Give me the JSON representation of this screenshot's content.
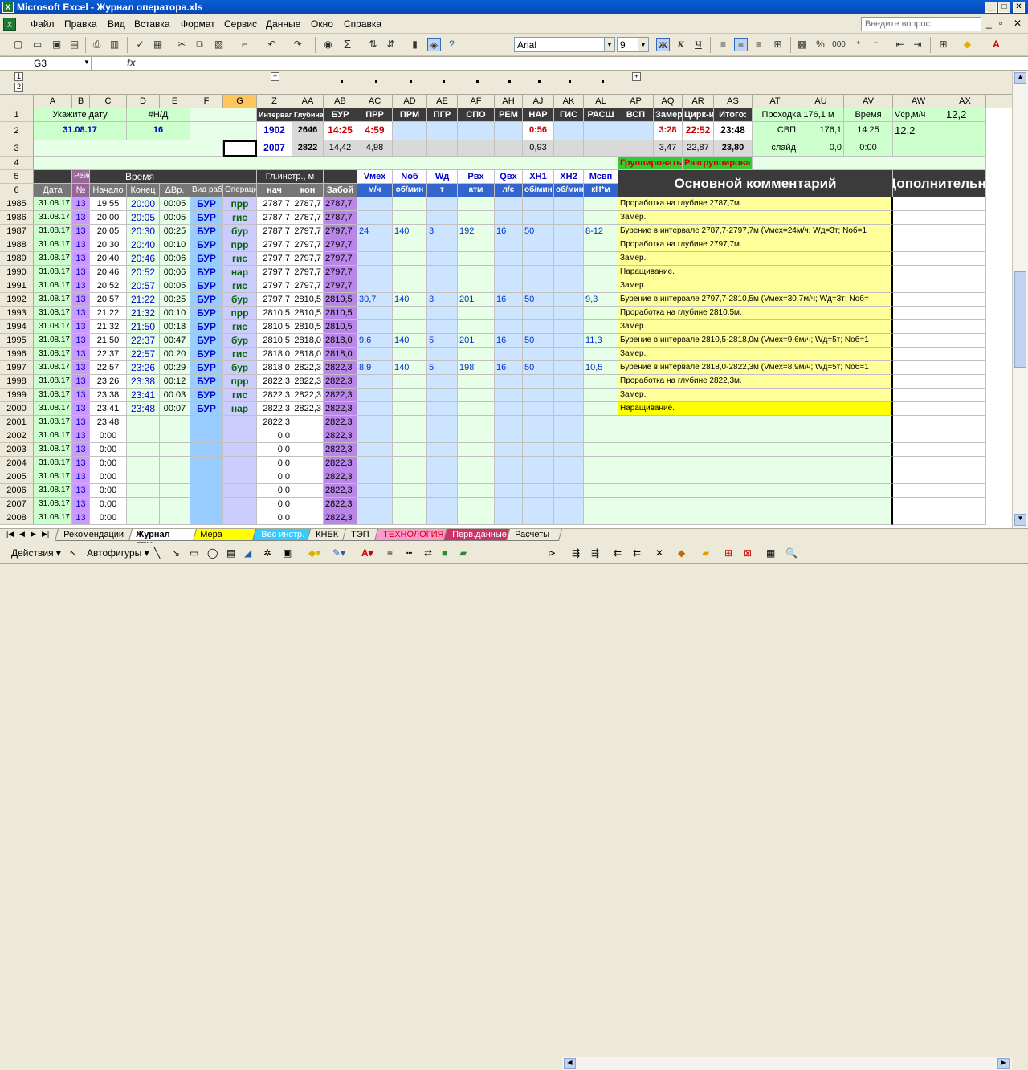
{
  "app": {
    "title": "Microsoft Excel - Журнал оператора.xls",
    "app_icon": "excel-icon"
  },
  "menu": {
    "items": [
      "Файл",
      "Правка",
      "Вид",
      "Вставка",
      "Формат",
      "Сервис",
      "Данные",
      "Окно",
      "Справка"
    ],
    "help_placeholder": "Введите вопрос"
  },
  "toolbar": {
    "font_name": "Arial",
    "font_size": "9",
    "bold": "Ж",
    "italic": "К",
    "underline": "Ч",
    "sigma": "Σ",
    "percent": "%",
    "thousands": "000"
  },
  "formula_bar": {
    "name_box": "G3",
    "fx": "fx",
    "value": ""
  },
  "columns": [
    "A",
    "B",
    "C",
    "D",
    "E",
    "F",
    "G",
    "Z",
    "AA",
    "AB",
    "AC",
    "AD",
    "AE",
    "AF",
    "AH",
    "AJ",
    "AK",
    "AL",
    "AP",
    "AQ",
    "AR",
    "AS",
    "AT",
    "AU",
    "AV",
    "AW",
    "AX"
  ],
  "outline": {
    "level1": "1",
    "level2": "2",
    "plus": "+"
  },
  "top": {
    "date_label": "Укажите дату",
    "date_value": "31.08.17",
    "nd_label": "#Н/Д",
    "nd_value": "16",
    "interval_label": "Интервал",
    "depth_label": "Глубина",
    "z2": "1902",
    "aa2": "2646",
    "z3": "2007",
    "aa3": "2822",
    "ops_headers": [
      "БУР",
      "ПРР",
      "ПРМ",
      "ПГР",
      "СПО",
      "РЕМ",
      "НАР",
      "ГИС",
      "РАСШ",
      "ВСП",
      "Замер",
      "Цирк-ия",
      "Итого:"
    ],
    "row2_vals": {
      "bur": "14:25",
      "prr": "4:59",
      "nar": "0:56",
      "zamer": "3:28",
      "cirk": "22:52",
      "itogo": "23:48"
    },
    "row3_vals": {
      "bur": "14,42",
      "prr": "4,98",
      "nar": "0,93",
      "zamer": "3,47",
      "cirk": "22,87",
      "itogo": "23,80"
    },
    "prohodka_label": "Проходка 176,1 м",
    "vremya_label": "Время",
    "vsr_label": "Vср,м/ч",
    "ax1": "12,2",
    "svp_label": "СВП",
    "svp_val": "176,1",
    "svp_time": "14:25",
    "svp_vsr": "12,2",
    "slide_label": "слайд",
    "slide_val": "0,0",
    "slide_time": "0:00",
    "group_btn": "Группировать",
    "ungroup_btn": "Разгруппировать"
  },
  "table_headers": {
    "r5": {
      "rejs": "Рейс",
      "vremya": "Время",
      "gl_instr": "Гл.инстр., м",
      "vmeh": "Vмех",
      "nob": "Nоб",
      "wd": "Wд",
      "rvh": "Рвх",
      "qvh": "Qвх",
      "xn1": "ХН1",
      "xn2": "ХН2",
      "msvp": "Мсвп"
    },
    "r6": {
      "date": "Дата",
      "no": "№",
      "start": "Начало",
      "end": "Конец",
      "dvr": "ΔВр.",
      "vid_raboty": "Вид работы",
      "operacii": "Операции",
      "nach": "нач",
      "kon": "кон",
      "zaboi": "Забой",
      "vmeh_u": "м/ч",
      "nob_u": "об/мин",
      "wd_u": "т",
      "rvh_u": "атм",
      "qvh_u": "л/с",
      "xn1_u": "об/мин",
      "xn2_u": "об/мин",
      "msvp_u": "кН*м"
    },
    "main_comment": "Основной комментарий",
    "extra_comment": "Дополнительный"
  },
  "rows": [
    {
      "n": "1985",
      "date": "31.08.17",
      "no": "13",
      "start": "19:55",
      "end": "20:00",
      "dvr": "00:05",
      "vid": "БУР",
      "op": "прр",
      "nach": "2787,7",
      "kon": "2787,7",
      "zaboi": "2787,7",
      "vmeh": "",
      "nob": "",
      "wd": "",
      "rvh": "",
      "qvh": "",
      "xn1": "",
      "msvp": "",
      "comment": "Проработка на глубине 2787,7м."
    },
    {
      "n": "1986",
      "date": "31.08.17",
      "no": "13",
      "start": "20:00",
      "end": "20:05",
      "dvr": "00:05",
      "vid": "БУР",
      "op": "гис",
      "nach": "2787,7",
      "kon": "2787,7",
      "zaboi": "2787,7",
      "vmeh": "",
      "nob": "",
      "wd": "",
      "rvh": "",
      "qvh": "",
      "xn1": "",
      "msvp": "",
      "comment": "Замер."
    },
    {
      "n": "1987",
      "date": "31.08.17",
      "no": "13",
      "start": "20:05",
      "end": "20:30",
      "dvr": "00:25",
      "vid": "БУР",
      "op": "бур",
      "nach": "2787,7",
      "kon": "2797,7",
      "zaboi": "2797,7",
      "vmeh": "24",
      "nob": "140",
      "wd": "3",
      "rvh": "192",
      "qvh": "16",
      "xn1": "50",
      "msvp": "8-12",
      "comment": "Бурение в интервале 2787,7-2797,7м (Vмех=24м/ч; Wд=3т; Nоб=1"
    },
    {
      "n": "1988",
      "date": "31.08.17",
      "no": "13",
      "start": "20:30",
      "end": "20:40",
      "dvr": "00:10",
      "vid": "БУР",
      "op": "прр",
      "nach": "2797,7",
      "kon": "2797,7",
      "zaboi": "2797,7",
      "vmeh": "",
      "nob": "",
      "wd": "",
      "rvh": "",
      "qvh": "",
      "xn1": "",
      "msvp": "",
      "comment": "Проработка на глубине 2797,7м."
    },
    {
      "n": "1989",
      "date": "31.08.17",
      "no": "13",
      "start": "20:40",
      "end": "20:46",
      "dvr": "00:06",
      "vid": "БУР",
      "op": "гис",
      "nach": "2797,7",
      "kon": "2797,7",
      "zaboi": "2797,7",
      "vmeh": "",
      "nob": "",
      "wd": "",
      "rvh": "",
      "qvh": "",
      "xn1": "",
      "msvp": "",
      "comment": "Замер."
    },
    {
      "n": "1990",
      "date": "31.08.17",
      "no": "13",
      "start": "20:46",
      "end": "20:52",
      "dvr": "00:06",
      "vid": "БУР",
      "op": "нар",
      "nach": "2797,7",
      "kon": "2797,7",
      "zaboi": "2797,7",
      "vmeh": "",
      "nob": "",
      "wd": "",
      "rvh": "",
      "qvh": "",
      "xn1": "",
      "msvp": "",
      "comment": "Наращивание."
    },
    {
      "n": "1991",
      "date": "31.08.17",
      "no": "13",
      "start": "20:52",
      "end": "20:57",
      "dvr": "00:05",
      "vid": "БУР",
      "op": "гис",
      "nach": "2797,7",
      "kon": "2797,7",
      "zaboi": "2797,7",
      "vmeh": "",
      "nob": "",
      "wd": "",
      "rvh": "",
      "qvh": "",
      "xn1": "",
      "msvp": "",
      "comment": "Замер."
    },
    {
      "n": "1992",
      "date": "31.08.17",
      "no": "13",
      "start": "20:57",
      "end": "21:22",
      "dvr": "00:25",
      "vid": "БУР",
      "op": "бур",
      "nach": "2797,7",
      "kon": "2810,5",
      "zaboi": "2810,5",
      "vmeh": "30,7",
      "nob": "140",
      "wd": "3",
      "rvh": "201",
      "qvh": "16",
      "xn1": "50",
      "msvp": "9,3",
      "comment": "Бурение в интервале 2797,7-2810,5м (Vмех=30,7м/ч; Wд=3т; Nоб="
    },
    {
      "n": "1993",
      "date": "31.08.17",
      "no": "13",
      "start": "21:22",
      "end": "21:32",
      "dvr": "00:10",
      "vid": "БУР",
      "op": "прр",
      "nach": "2810,5",
      "kon": "2810,5",
      "zaboi": "2810,5",
      "vmeh": "",
      "nob": "",
      "wd": "",
      "rvh": "",
      "qvh": "",
      "xn1": "",
      "msvp": "",
      "comment": "Проработка на глубине 2810,5м."
    },
    {
      "n": "1994",
      "date": "31.08.17",
      "no": "13",
      "start": "21:32",
      "end": "21:50",
      "dvr": "00:18",
      "vid": "БУР",
      "op": "гис",
      "nach": "2810,5",
      "kon": "2810,5",
      "zaboi": "2810,5",
      "vmeh": "",
      "nob": "",
      "wd": "",
      "rvh": "",
      "qvh": "",
      "xn1": "",
      "msvp": "",
      "comment": "Замер."
    },
    {
      "n": "1995",
      "date": "31.08.17",
      "no": "13",
      "start": "21:50",
      "end": "22:37",
      "dvr": "00:47",
      "vid": "БУР",
      "op": "бур",
      "nach": "2810,5",
      "kon": "2818,0",
      "zaboi": "2818,0",
      "vmeh": "9,6",
      "nob": "140",
      "wd": "5",
      "rvh": "201",
      "qvh": "16",
      "xn1": "50",
      "msvp": "11,3",
      "comment": "Бурение в интервале 2810,5-2818,0м (Vмех=9,6м/ч; Wд=5т; Nоб=1"
    },
    {
      "n": "1996",
      "date": "31.08.17",
      "no": "13",
      "start": "22:37",
      "end": "22:57",
      "dvr": "00:20",
      "vid": "БУР",
      "op": "гис",
      "nach": "2818,0",
      "kon": "2818,0",
      "zaboi": "2818,0",
      "vmeh": "",
      "nob": "",
      "wd": "",
      "rvh": "",
      "qvh": "",
      "xn1": "",
      "msvp": "",
      "comment": "Замер."
    },
    {
      "n": "1997",
      "date": "31.08.17",
      "no": "13",
      "start": "22:57",
      "end": "23:26",
      "dvr": "00:29",
      "vid": "БУР",
      "op": "бур",
      "nach": "2818,0",
      "kon": "2822,3",
      "zaboi": "2822,3",
      "vmeh": "8,9",
      "nob": "140",
      "wd": "5",
      "rvh": "198",
      "qvh": "16",
      "xn1": "50",
      "msvp": "10,5",
      "comment": "Бурение в интервале 2818,0-2822,3м (Vмех=8,9м/ч; Wд=5т; Nоб=1"
    },
    {
      "n": "1998",
      "date": "31.08.17",
      "no": "13",
      "start": "23:26",
      "end": "23:38",
      "dvr": "00:12",
      "vid": "БУР",
      "op": "прр",
      "nach": "2822,3",
      "kon": "2822,3",
      "zaboi": "2822,3",
      "vmeh": "",
      "nob": "",
      "wd": "",
      "rvh": "",
      "qvh": "",
      "xn1": "",
      "msvp": "",
      "comment": "Проработка на глубине 2822,3м."
    },
    {
      "n": "1999",
      "date": "31.08.17",
      "no": "13",
      "start": "23:38",
      "end": "23:41",
      "dvr": "00:03",
      "vid": "БУР",
      "op": "гис",
      "nach": "2822,3",
      "kon": "2822,3",
      "zaboi": "2822,3",
      "vmeh": "",
      "nob": "",
      "wd": "",
      "rvh": "",
      "qvh": "",
      "xn1": "",
      "msvp": "",
      "comment": "Замер."
    },
    {
      "n": "2000",
      "date": "31.08.17",
      "no": "13",
      "start": "23:41",
      "end": "23:48",
      "dvr": "00:07",
      "vid": "БУР",
      "op": "нар",
      "nach": "2822,3",
      "kon": "2822,3",
      "zaboi": "2822,3",
      "vmeh": "",
      "nob": "",
      "wd": "",
      "rvh": "",
      "qvh": "",
      "xn1": "",
      "msvp": "",
      "comment": "Наращивание."
    },
    {
      "n": "2001",
      "date": "31.08.17",
      "no": "13",
      "start": "23:48",
      "end": "",
      "dvr": "",
      "vid": "",
      "op": "",
      "nach": "2822,3",
      "kon": "",
      "zaboi": "2822,3",
      "vmeh": "",
      "nob": "",
      "wd": "",
      "rvh": "",
      "qvh": "",
      "xn1": "",
      "msvp": "",
      "comment": ""
    },
    {
      "n": "2002",
      "date": "31.08.17",
      "no": "13",
      "start": "0:00",
      "end": "",
      "dvr": "",
      "vid": "",
      "op": "",
      "nach": "0,0",
      "kon": "",
      "zaboi": "2822,3",
      "vmeh": "",
      "nob": "",
      "wd": "",
      "rvh": "",
      "qvh": "",
      "xn1": "",
      "msvp": "",
      "comment": ""
    },
    {
      "n": "2003",
      "date": "31.08.17",
      "no": "13",
      "start": "0:00",
      "end": "",
      "dvr": "",
      "vid": "",
      "op": "",
      "nach": "0,0",
      "kon": "",
      "zaboi": "2822,3",
      "vmeh": "",
      "nob": "",
      "wd": "",
      "rvh": "",
      "qvh": "",
      "xn1": "",
      "msvp": "",
      "comment": ""
    },
    {
      "n": "2004",
      "date": "31.08.17",
      "no": "13",
      "start": "0:00",
      "end": "",
      "dvr": "",
      "vid": "",
      "op": "",
      "nach": "0,0",
      "kon": "",
      "zaboi": "2822,3",
      "vmeh": "",
      "nob": "",
      "wd": "",
      "rvh": "",
      "qvh": "",
      "xn1": "",
      "msvp": "",
      "comment": ""
    },
    {
      "n": "2005",
      "date": "31.08.17",
      "no": "13",
      "start": "0:00",
      "end": "",
      "dvr": "",
      "vid": "",
      "op": "",
      "nach": "0,0",
      "kon": "",
      "zaboi": "2822,3",
      "vmeh": "",
      "nob": "",
      "wd": "",
      "rvh": "",
      "qvh": "",
      "xn1": "",
      "msvp": "",
      "comment": ""
    },
    {
      "n": "2006",
      "date": "31.08.17",
      "no": "13",
      "start": "0:00",
      "end": "",
      "dvr": "",
      "vid": "",
      "op": "",
      "nach": "0,0",
      "kon": "",
      "zaboi": "2822,3",
      "vmeh": "",
      "nob": "",
      "wd": "",
      "rvh": "",
      "qvh": "",
      "xn1": "",
      "msvp": "",
      "comment": ""
    },
    {
      "n": "2007",
      "date": "31.08.17",
      "no": "13",
      "start": "0:00",
      "end": "",
      "dvr": "",
      "vid": "",
      "op": "",
      "nach": "0,0",
      "kon": "",
      "zaboi": "2822,3",
      "vmeh": "",
      "nob": "",
      "wd": "",
      "rvh": "",
      "qvh": "",
      "xn1": "",
      "msvp": "",
      "comment": ""
    },
    {
      "n": "2008",
      "date": "31.08.17",
      "no": "13",
      "start": "0:00",
      "end": "",
      "dvr": "",
      "vid": "",
      "op": "",
      "nach": "0,0",
      "kon": "",
      "zaboi": "2822,3",
      "vmeh": "",
      "nob": "",
      "wd": "",
      "rvh": "",
      "qvh": "",
      "xn1": "",
      "msvp": "",
      "comment": ""
    }
  ],
  "sheets": [
    {
      "name": "Рекомендации",
      "color": "#ece9d8",
      "text": "#000"
    },
    {
      "name": "Журнал ГТИ",
      "color": "#ffffff",
      "text": "#000",
      "active": true
    },
    {
      "name": "Мера инстр.",
      "color": "#ffff00",
      "text": "#000"
    },
    {
      "name": "Вес инстр.",
      "color": "#33ccff",
      "text": "#fff"
    },
    {
      "name": "КНБК",
      "color": "#ece9d8",
      "text": "#000"
    },
    {
      "name": "ТЭП",
      "color": "#ece9d8",
      "text": "#000"
    },
    {
      "name": "ТЕХНОЛОГИЯ",
      "color": "#ff99cc",
      "text": "#cc0000"
    },
    {
      "name": "Перв.данные",
      "color": "#cc3366",
      "text": "#fff"
    },
    {
      "name": "Расчеты",
      "color": "#ece9d8",
      "text": "#000"
    }
  ],
  "drawbar": {
    "actions": "Действия",
    "autoshapes": "Автофигуры"
  }
}
